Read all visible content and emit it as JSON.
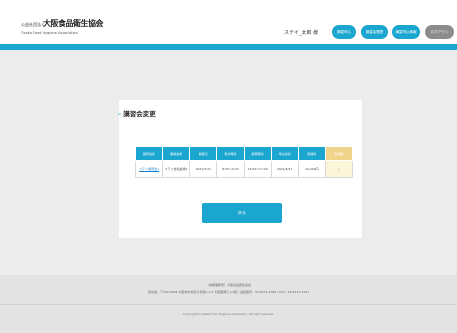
{
  "header": {
    "org_prefix": "公益社団法人",
    "org_name": "大阪食品衛生協会",
    "org_en": "Osaka Food Hygiene Association",
    "user_name": "ステイ_太郎 様",
    "buttons": [
      "講習申込",
      "講習会履歴",
      "講習申込情報",
      "ログアウト"
    ]
  },
  "main": {
    "title": "講習会変更",
    "table": {
      "headers": [
        "講習会名",
        "開催会場",
        "開催日",
        "受付時間",
        "講習時間",
        "申込締切",
        "受講料",
        "取消等"
      ],
      "rows": [
        [
          "ステイ講習会1",
          "ステイ食協会場1",
          "2021/5/31",
          "8:50～9:20",
          "13:00～17:00",
          "2021/5/21",
          "10,000円",
          "△"
        ]
      ]
    },
    "back_label": "戻る"
  },
  "footer": {
    "line1": "〈本部事務局〉大阪食品衛生協会",
    "line2": "所在地：〒540-0008 大阪市中央区大手前2-1-2 大阪国際ビル5階 / 電話番号：06-6231-2366 / FAX：06-6231-2447",
    "copyright": "Copyright(C) Osaka Food Hygiene Association. All right reserved."
  },
  "colors": {
    "accent": "#1aa6cf",
    "logout": "#8c8c8c",
    "background": "#ececec"
  }
}
